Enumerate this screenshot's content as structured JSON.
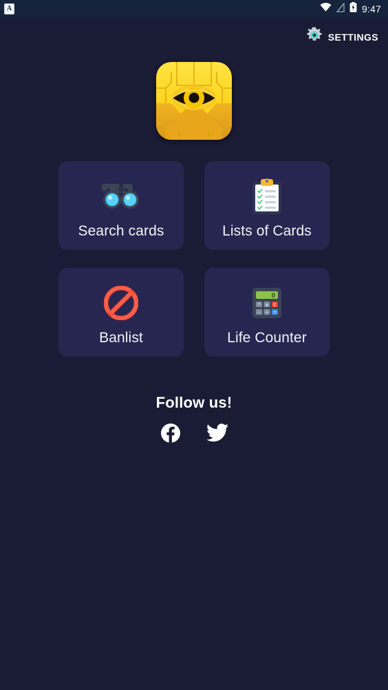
{
  "statusbar": {
    "app_badge_glyph": "A",
    "time": "9:47",
    "icons": [
      "wifi-icon",
      "signal-off-icon",
      "battery-charging-icon"
    ]
  },
  "header": {
    "settings_label": "SETTINGS",
    "settings_icon": "gear-icon"
  },
  "logo": {
    "name": "millennium-puzzle-eye-logo",
    "colors": {
      "gold_light": "#ffe02e",
      "gold": "#fac800",
      "gold_dark": "#d99a15",
      "amber": "#e8a61c"
    }
  },
  "menu": {
    "items": [
      {
        "label": "Search cards",
        "icon": "binoculars-icon"
      },
      {
        "label": "Lists of Cards",
        "icon": "clipboard-checklist-icon"
      },
      {
        "label": "Banlist",
        "icon": "prohibition-icon"
      },
      {
        "label": "Life Counter",
        "icon": "calculator-icon"
      }
    ]
  },
  "calculator": {
    "display_value": "0",
    "keys": [
      "*",
      "x",
      "C",
      "-",
      "÷",
      "="
    ]
  },
  "follow": {
    "title": "Follow us!",
    "links": [
      {
        "name": "facebook-icon"
      },
      {
        "name": "twitter-icon"
      }
    ]
  },
  "colors": {
    "background": "#1a1b34",
    "statusbar_bg": "#15233c",
    "card_bg": "#272650",
    "text": "#f2f3f7",
    "accent_teal": "#4fd9c8",
    "danger_red": "#f04a38",
    "lcd_green": "#8bc34a"
  }
}
